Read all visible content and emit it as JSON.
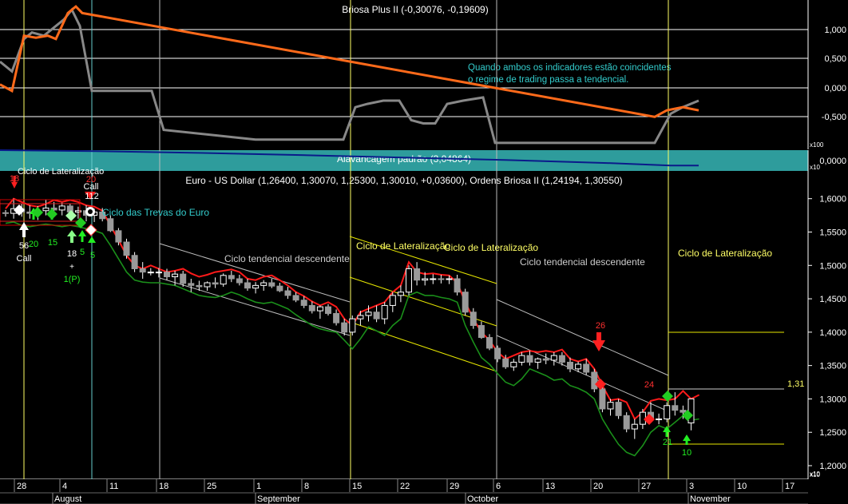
{
  "colors": {
    "background": "#000000",
    "grid": "#ffffff",
    "vline_yellow": "#ffff66",
    "vline_cyan": "#66cccc",
    "osc_grey": "#888888",
    "osc_orange": "#ff6a1a",
    "lev_band": "#2e9c9c",
    "lev_line": "#0a1a8a",
    "bull_body": "#ffffff",
    "bear_body": "#9a9a9a",
    "upper_band": "#ff1a1a",
    "lower_band": "#1a8f1a",
    "channel_white": "#bfbfbf",
    "channel_yellow": "#e6e600",
    "note_cyan": "#33cccc",
    "label_white": "#dddddd",
    "label_yellow": "#ffff66",
    "signal_green": "#22ee22",
    "signal_red": "#ff2020"
  },
  "panels": {
    "oscillator": {
      "title": "Briosa Plus II (-0,30076, -0,19609)",
      "ticks": [
        "1,000",
        "0,500",
        "0,000",
        "-0,500"
      ],
      "note": [
        "Quando ambos os indicadores estão coincidentes",
        "o regime de trading passa a tendencial."
      ]
    },
    "leverage": {
      "title": "Alavancagem padrão (3,04864)",
      "tick": "0,0000",
      "scale_top": "x100",
      "scale_bottom": "x10"
    },
    "price": {
      "title": "Euro - US Dollar (1,26400, 1,30070, 1,25300, 1,30010, +0,03600), Ordens Briosa II (1,24194, 1,30550)",
      "ticks": [
        "1,6000",
        "1,5500",
        "1,5000",
        "1,4500",
        "1,4000",
        "1,3500",
        "1,3000",
        "1,2500",
        "1,2000"
      ],
      "scale_label": "x10",
      "level_label": "1,31"
    }
  },
  "annotations": {
    "cycles": [
      "Ciclo de Lateralização",
      "Ciclo das Trevas do Euro",
      "Ciclo tendencial descendente",
      "Ciclo de Lateralização",
      "Ciclo de Lateralização",
      "Ciclo tendencial descendente",
      "Ciclo de Lateralização"
    ],
    "signals": {
      "n18a": "18",
      "n20a": "20",
      "call1": "Call",
      "n112": "112",
      "n56": "56",
      "call2": "Call",
      "n20b": "20",
      "n15": "15",
      "n18b": "18",
      "plus": "+",
      "onep": "1(P)",
      "n5a": "5",
      "n5b": "5",
      "n26": "26",
      "n24": "24",
      "n21": "21",
      "n10": "10"
    }
  },
  "x_axis": {
    "day_ticks": [
      "28",
      "4",
      "11",
      "18",
      "25",
      "1",
      "8",
      "15",
      "22",
      "29",
      "6",
      "13",
      "20",
      "27",
      "3",
      "10",
      "17"
    ],
    "months": [
      "August",
      "September",
      "October",
      "November"
    ],
    "scale_label": "x10"
  },
  "chart_data": {
    "type": "candlestick",
    "title": "Euro - US Dollar (1,26400, 1,30070, 1,25300, 1,30010, +0,03600), Ordens Briosa II (1,24194, 1,30550)",
    "xlabel": "",
    "ylabel": "",
    "x_tick_labels": [
      "28",
      "4",
      "11",
      "18",
      "25",
      "1",
      "8",
      "15",
      "22",
      "29",
      "6",
      "13",
      "20",
      "27",
      "3",
      "10",
      "17"
    ],
    "ylim": [
      1.2,
      1.62
    ],
    "candles": [
      [
        1.579,
        1.583,
        1.573,
        1.578
      ],
      [
        1.578,
        1.6,
        1.57,
        1.585
      ],
      [
        1.585,
        1.592,
        1.573,
        1.58
      ],
      [
        1.58,
        1.59,
        1.57,
        1.578
      ],
      [
        1.578,
        1.589,
        1.568,
        1.582
      ],
      [
        1.582,
        1.598,
        1.575,
        1.586
      ],
      [
        1.586,
        1.595,
        1.578,
        1.583
      ],
      [
        1.583,
        1.594,
        1.575,
        1.589
      ],
      [
        1.589,
        1.593,
        1.577,
        1.58
      ],
      [
        1.58,
        1.588,
        1.57,
        1.582
      ],
      [
        1.582,
        1.59,
        1.566,
        1.575
      ],
      [
        1.575,
        1.585,
        1.565,
        1.58
      ],
      [
        1.58,
        1.586,
        1.566,
        1.57
      ],
      [
        1.57,
        1.575,
        1.55,
        1.552
      ],
      [
        1.552,
        1.556,
        1.53,
        1.535
      ],
      [
        1.535,
        1.54,
        1.51,
        1.515
      ],
      [
        1.515,
        1.52,
        1.49,
        1.495
      ],
      [
        1.495,
        1.505,
        1.48,
        1.49
      ],
      [
        1.49,
        1.496,
        1.485,
        1.49
      ],
      [
        1.49,
        1.496,
        1.482,
        1.49
      ],
      [
        1.49,
        1.495,
        1.478,
        1.483
      ],
      [
        1.483,
        1.492,
        1.47,
        1.487
      ],
      [
        1.487,
        1.492,
        1.468,
        1.473
      ],
      [
        1.473,
        1.48,
        1.46,
        1.47
      ],
      [
        1.47,
        1.477,
        1.462,
        1.468
      ],
      [
        1.468,
        1.476,
        1.462,
        1.474
      ],
      [
        1.474,
        1.482,
        1.466,
        1.472
      ],
      [
        1.472,
        1.488,
        1.468,
        1.485
      ],
      [
        1.485,
        1.492,
        1.475,
        1.48
      ],
      [
        1.48,
        1.486,
        1.47,
        1.474
      ],
      [
        1.474,
        1.48,
        1.462,
        1.466
      ],
      [
        1.466,
        1.475,
        1.458,
        1.47
      ],
      [
        1.47,
        1.478,
        1.462,
        1.474
      ],
      [
        1.474,
        1.48,
        1.466,
        1.469
      ],
      [
        1.469,
        1.474,
        1.46,
        1.462
      ],
      [
        1.462,
        1.468,
        1.45,
        1.455
      ],
      [
        1.455,
        1.46,
        1.445,
        1.448
      ],
      [
        1.448,
        1.454,
        1.436,
        1.44
      ],
      [
        1.44,
        1.446,
        1.428,
        1.432
      ],
      [
        1.432,
        1.44,
        1.42,
        1.438
      ],
      [
        1.438,
        1.442,
        1.425,
        1.428
      ],
      [
        1.428,
        1.434,
        1.41,
        1.414
      ],
      [
        1.414,
        1.42,
        1.395,
        1.4
      ],
      [
        1.4,
        1.425,
        1.395,
        1.42
      ],
      [
        1.42,
        1.432,
        1.41,
        1.425
      ],
      [
        1.425,
        1.44,
        1.416,
        1.43
      ],
      [
        1.43,
        1.44,
        1.415,
        1.42
      ],
      [
        1.42,
        1.445,
        1.412,
        1.44
      ],
      [
        1.44,
        1.46,
        1.43,
        1.455
      ],
      [
        1.455,
        1.47,
        1.445,
        1.46
      ],
      [
        1.46,
        1.5,
        1.455,
        1.495
      ],
      [
        1.495,
        1.505,
        1.47,
        1.478
      ],
      [
        1.478,
        1.49,
        1.47,
        1.48
      ],
      [
        1.48,
        1.487,
        1.472,
        1.48
      ],
      [
        1.48,
        1.486,
        1.473,
        1.479
      ],
      [
        1.479,
        1.485,
        1.472,
        1.48
      ],
      [
        1.48,
        1.486,
        1.455,
        1.46
      ],
      [
        1.46,
        1.465,
        1.425,
        1.43
      ],
      [
        1.43,
        1.436,
        1.405,
        1.41
      ],
      [
        1.41,
        1.416,
        1.39,
        1.392
      ],
      [
        1.392,
        1.397,
        1.373,
        1.376
      ],
      [
        1.376,
        1.38,
        1.355,
        1.36
      ],
      [
        1.36,
        1.366,
        1.345,
        1.348
      ],
      [
        1.348,
        1.36,
        1.342,
        1.355
      ],
      [
        1.355,
        1.37,
        1.35,
        1.365
      ],
      [
        1.365,
        1.372,
        1.35,
        1.355
      ],
      [
        1.355,
        1.362,
        1.345,
        1.36
      ],
      [
        1.36,
        1.368,
        1.352,
        1.358
      ],
      [
        1.358,
        1.37,
        1.35,
        1.365
      ],
      [
        1.365,
        1.37,
        1.35,
        1.355
      ],
      [
        1.355,
        1.362,
        1.34,
        1.345
      ],
      [
        1.345,
        1.356,
        1.34,
        1.352
      ],
      [
        1.352,
        1.36,
        1.336,
        1.34
      ],
      [
        1.34,
        1.345,
        1.31,
        1.315
      ],
      [
        1.315,
        1.32,
        1.28,
        1.285
      ],
      [
        1.285,
        1.3,
        1.275,
        1.295
      ],
      [
        1.295,
        1.3,
        1.27,
        1.275
      ],
      [
        1.275,
        1.28,
        1.25,
        1.255
      ],
      [
        1.255,
        1.27,
        1.24,
        1.262
      ],
      [
        1.262,
        1.285,
        1.255,
        1.28
      ],
      [
        1.28,
        1.295,
        1.265,
        1.27
      ],
      [
        1.27,
        1.278,
        1.262,
        1.27
      ],
      [
        1.27,
        1.295,
        1.265,
        1.29
      ],
      [
        1.29,
        1.31,
        1.275,
        1.283
      ],
      [
        1.283,
        1.29,
        1.27,
        1.28
      ],
      [
        1.264,
        1.3007,
        1.253,
        1.3001
      ]
    ],
    "series": [
      {
        "values": [
          1.585,
          1.6,
          1.595,
          1.59,
          1.588,
          1.592,
          1.598,
          1.595,
          1.598,
          1.595,
          1.59,
          1.588,
          1.582,
          1.56,
          1.538,
          1.515,
          1.5,
          1.495,
          1.5,
          1.495,
          1.49,
          1.492,
          1.495,
          1.488,
          1.483,
          1.486,
          1.49,
          1.492,
          1.494,
          1.49,
          1.48,
          1.478,
          1.483,
          1.485,
          1.478,
          1.47,
          1.46,
          1.454,
          1.446,
          1.44,
          1.445,
          1.438,
          1.42,
          1.41,
          1.43,
          1.435,
          1.44,
          1.445,
          1.46,
          1.47,
          1.505,
          1.49,
          1.487,
          1.488,
          1.486,
          1.485,
          1.474,
          1.445,
          1.42,
          1.4,
          1.388,
          1.37,
          1.36,
          1.365,
          1.37,
          1.372,
          1.37,
          1.372,
          1.37,
          1.374,
          1.36,
          1.356,
          1.36,
          1.345,
          1.32,
          1.298,
          1.3,
          1.295,
          1.27,
          1.28,
          1.297,
          1.3,
          1.298,
          1.3,
          1.312,
          1.3,
          1.306
        ]
      },
      {
        "values": [
          1.563,
          1.565,
          1.56,
          1.558,
          1.56,
          1.562,
          1.56,
          1.558,
          1.56,
          1.558,
          1.555,
          1.552,
          1.548,
          1.53,
          1.51,
          1.49,
          1.478,
          1.475,
          1.474,
          1.474,
          1.472,
          1.47,
          1.465,
          1.46,
          1.455,
          1.453,
          1.452,
          1.455,
          1.46,
          1.456,
          1.45,
          1.445,
          1.443,
          1.445,
          1.44,
          1.435,
          1.426,
          1.418,
          1.41,
          1.405,
          1.402,
          1.4,
          1.388,
          1.375,
          1.39,
          1.408,
          1.402,
          1.395,
          1.41,
          1.42,
          1.455,
          1.46,
          1.455,
          1.455,
          1.452,
          1.45,
          1.445,
          1.41,
          1.385,
          1.362,
          1.352,
          1.338,
          1.325,
          1.32,
          1.33,
          1.345,
          1.34,
          1.335,
          1.328,
          1.33,
          1.32,
          1.316,
          1.31,
          1.3,
          1.27,
          1.25,
          1.232,
          1.22,
          1.215,
          1.23,
          1.25,
          1.26,
          1.255,
          1.265,
          1.275,
          1.268,
          1.27
        ]
      }
    ],
    "oscillator": {
      "ylim": [
        -0.9,
        1.4
      ],
      "series": [
        {
          "x": [
            0,
            15,
            30,
            40,
            55,
            65,
            80,
            90,
            100,
            115,
            190,
            205,
            320,
            410,
            430,
            445,
            460,
            480,
            500,
            515,
            530,
            545,
            560,
            580,
            605,
            620,
            700,
            800,
            820,
            840,
            855,
            875
          ],
          "values": [
            0.45,
            0.3,
            0.8,
            0.9,
            0.85,
            0.95,
            1.1,
            1.25,
            1.0,
            0.0,
            0.0,
            -0.6,
            -0.75,
            -0.75,
            -0.75,
            -0.25,
            -0.2,
            -0.15,
            -0.15,
            -0.45,
            -0.5,
            -0.5,
            -0.2,
            -0.15,
            -0.1,
            -0.8,
            -0.8,
            -0.8,
            -0.8,
            -0.35,
            -0.25,
            -0.15
          ]
        },
        {
          "x": [
            0,
            15,
            30,
            45,
            60,
            70,
            85,
            95,
            103,
            820,
            835,
            855,
            875
          ],
          "values": [
            0.1,
            0.0,
            0.85,
            0.82,
            0.85,
            0.8,
            1.2,
            1.3,
            1.2,
            -0.4,
            -0.3,
            -0.25,
            -0.3
          ]
        }
      ]
    },
    "leverage_line": {
      "x": [
        0,
        120,
        260,
        400,
        520,
        640,
        760,
        840,
        875
      ],
      "values": [
        1.0,
        0.95,
        0.85,
        0.72,
        0.6,
        0.48,
        0.33,
        0.2,
        0.2
      ]
    }
  }
}
